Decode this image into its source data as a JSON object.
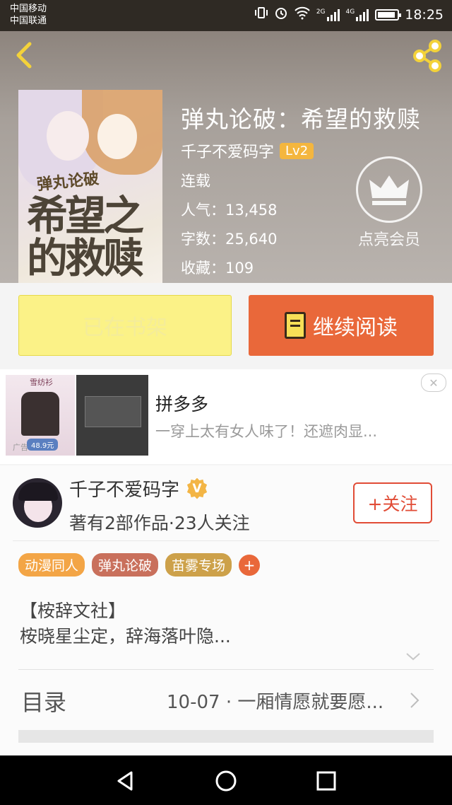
{
  "status_bar": {
    "carrier1": "中国移动",
    "carrier2": "中国联通",
    "net2g": "2G",
    "net4g": "4G",
    "time": "18:25"
  },
  "book": {
    "title": "弹丸论破：希望的救赎",
    "author": "千子不爱码字",
    "level": "Lv2",
    "status": "连载",
    "popularity": "人气：13,458",
    "word_count": "字数：25,640",
    "favorites": "收藏：109",
    "cover_subtitle": "弹丸论破",
    "cover_title": "希望之的救赎"
  },
  "vip": {
    "label": "点亮会员"
  },
  "actions": {
    "shelf_label": "已在书架",
    "read_label": "继续阅读"
  },
  "ad": {
    "title": "拼多多",
    "desc": "一穿上太有女人味了！还遮肉显...",
    "close": "✕",
    "img_top": "雪纺衫",
    "img_price": "48.9元",
    "img_label": "广告"
  },
  "author_section": {
    "name": "千子不爱码字",
    "verified": "V",
    "meta": "著有2部作品·23人关注",
    "follow_label": "+关注",
    "tags": [
      "动漫同人",
      "弹丸论破",
      "苗雾专场"
    ],
    "tag_add": "+",
    "intro": "【桉辞文社】\n桉晓星尘定，辞海落叶隐..."
  },
  "toc": {
    "label": "目录",
    "latest": "10-07 · 一厢情愿就要愿..."
  },
  "colors": {
    "accent_orange": "#e9683a",
    "shelf_yellow": "#fbf287",
    "follow_red": "#e14c36",
    "level_badge": "#f4b63e"
  },
  "icons": [
    "back-icon",
    "share-icon",
    "crown-icon",
    "book-icon",
    "verified-icon",
    "chevron-down-icon",
    "chevron-right-icon",
    "nav-back-icon",
    "nav-home-icon",
    "nav-recent-icon"
  ]
}
